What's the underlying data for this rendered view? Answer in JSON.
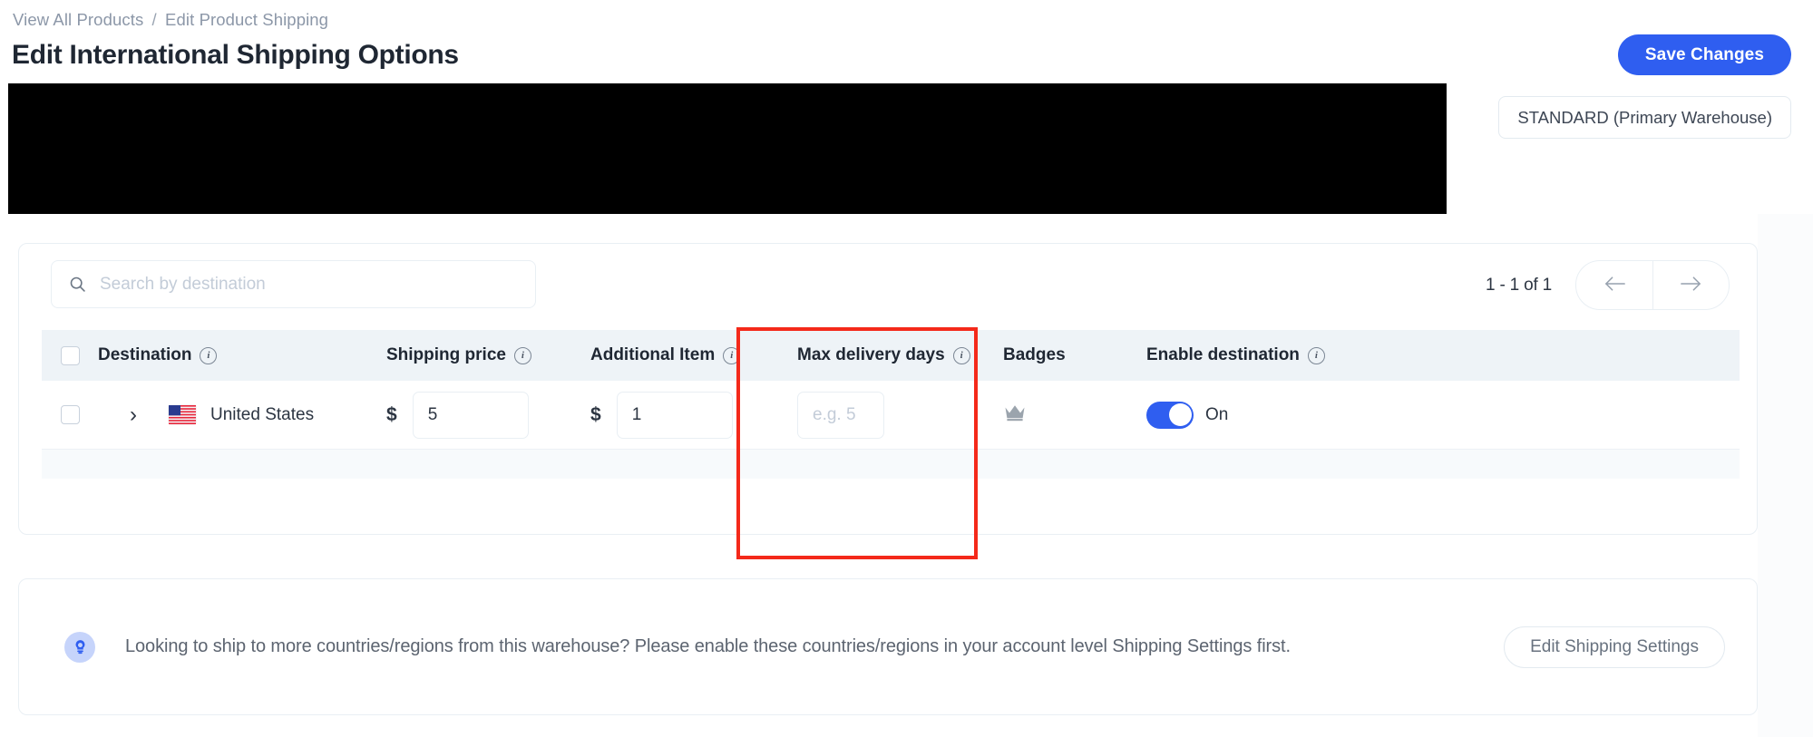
{
  "breadcrumb": {
    "items": [
      "View All Products",
      "Edit Product Shipping"
    ],
    "separator": "/"
  },
  "header": {
    "title": "Edit International Shipping Options",
    "save_label": "Save Changes",
    "warehouse_selected": "STANDARD (Primary Warehouse)"
  },
  "toolbar": {
    "search_placeholder": "Search by destination",
    "search_value": "",
    "search_icon": "search-icon",
    "pagination_label": "1 - 1 of 1",
    "prev_icon": "arrow-left-icon",
    "next_icon": "arrow-right-icon"
  },
  "table": {
    "columns": [
      {
        "key": "select",
        "label": "",
        "info": false
      },
      {
        "key": "destination",
        "label": "Destination",
        "info": true
      },
      {
        "key": "shipping_price",
        "label": "Shipping price",
        "info": true
      },
      {
        "key": "additional_item",
        "label": "Additional Item",
        "info": true
      },
      {
        "key": "max_delivery_days",
        "label": "Max delivery days",
        "info": true
      },
      {
        "key": "badges",
        "label": "Badges",
        "info": false
      },
      {
        "key": "enable_destination",
        "label": "Enable destination",
        "info": true
      }
    ],
    "info_glyph": "i",
    "rows": [
      {
        "selected": false,
        "expand_icon": "chevron-right-icon",
        "flag_icon": "flag-us-icon",
        "destination": "United States",
        "currency_symbol": "$",
        "shipping_price": "5",
        "shipping_price_placeholder": "",
        "additional_item_currency": "$",
        "additional_item": "1",
        "additional_item_placeholder": "",
        "max_delivery_days": "",
        "max_delivery_days_placeholder": "e.g. 5",
        "badge_icon": "crown-icon",
        "enabled": true,
        "enabled_label": "On"
      }
    ]
  },
  "notice": {
    "icon": "lightbulb-icon",
    "text": "Looking to ship to more countries/regions from this warehouse? Please enable these countries/regions in your account level Shipping Settings first.",
    "button_label": "Edit Shipping Settings"
  },
  "annotation": {
    "highlight_color": "#f4291a",
    "highlight_target": "Additional Item"
  },
  "colors": {
    "accent": "#2f5ef0",
    "header_bg": "#eef3f7",
    "text": "#1f2733",
    "muted": "#8c97a8"
  }
}
